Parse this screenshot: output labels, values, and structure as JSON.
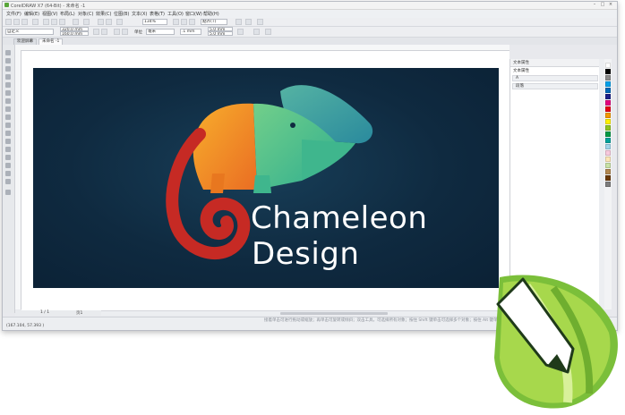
{
  "window": {
    "title": "CorelDRAW X7 (64-Bit) - 未命名 -1",
    "controls": [
      "–",
      "□",
      "×"
    ]
  },
  "menubar": {
    "items": [
      "文件(F)",
      "编辑(E)",
      "视图(V)",
      "布局(L)",
      "对象(C)",
      "效果(C)",
      "位图(B)",
      "文本(X)",
      "表格(T)",
      "工具(O)",
      "窗口(W)",
      "帮助(H)"
    ]
  },
  "toolbar": {
    "zoom": "134%",
    "snap_to": "贴齐(T)"
  },
  "propertybar": {
    "page_size": "自定义",
    "width": "320.0 mm",
    "height": "160.0 mm",
    "units_label": "单位",
    "units": "毫米",
    "nudge": ".1 mm",
    "dup_x": "5.0 mm",
    "dup_y": "5.0 mm"
  },
  "tabs": [
    {
      "label": "欢迎屏幕",
      "active": false
    },
    {
      "label": "未命名 -1",
      "active": true
    }
  ],
  "artwork": {
    "line1": "Chameleon",
    "line2": "Design",
    "colors": {
      "background": "#0f2a40",
      "red": "#c62a24",
      "orange": "#f08a23",
      "yellow": "#f7ae2c",
      "green": "#4cc08e",
      "teal": "#3a9aa0"
    }
  },
  "docker": {
    "title": "文本属性",
    "section": "文本属性",
    "rows": [
      "A",
      "段落"
    ]
  },
  "page_nav": {
    "count": "1 / 1",
    "page_tab": "页1"
  },
  "status": {
    "coords": "(167.104, 57.393 )",
    "hint": "接着单击可进行拖动或缩放；再单击可旋转或倾斜；双击工具，可选择所有对象；按住 Shift 键单击可选择多个对象；按住 Alt 键单击可进行挖掘；按住 Ctrl 并单击可在组中选择一个对象"
  },
  "palette_colors": [
    "#ffffff",
    "#000000",
    "#8a8a8a",
    "#00a0e9",
    "#0068b7",
    "#1d2088",
    "#e4007f",
    "#e60012",
    "#f39800",
    "#fff100",
    "#8fc31f",
    "#009944",
    "#00a29a",
    "#a0d3e8",
    "#f7c9dd",
    "#fce5b6",
    "#c8e1a5",
    "#b28850",
    "#6a3906",
    "#7d7d7d"
  ]
}
